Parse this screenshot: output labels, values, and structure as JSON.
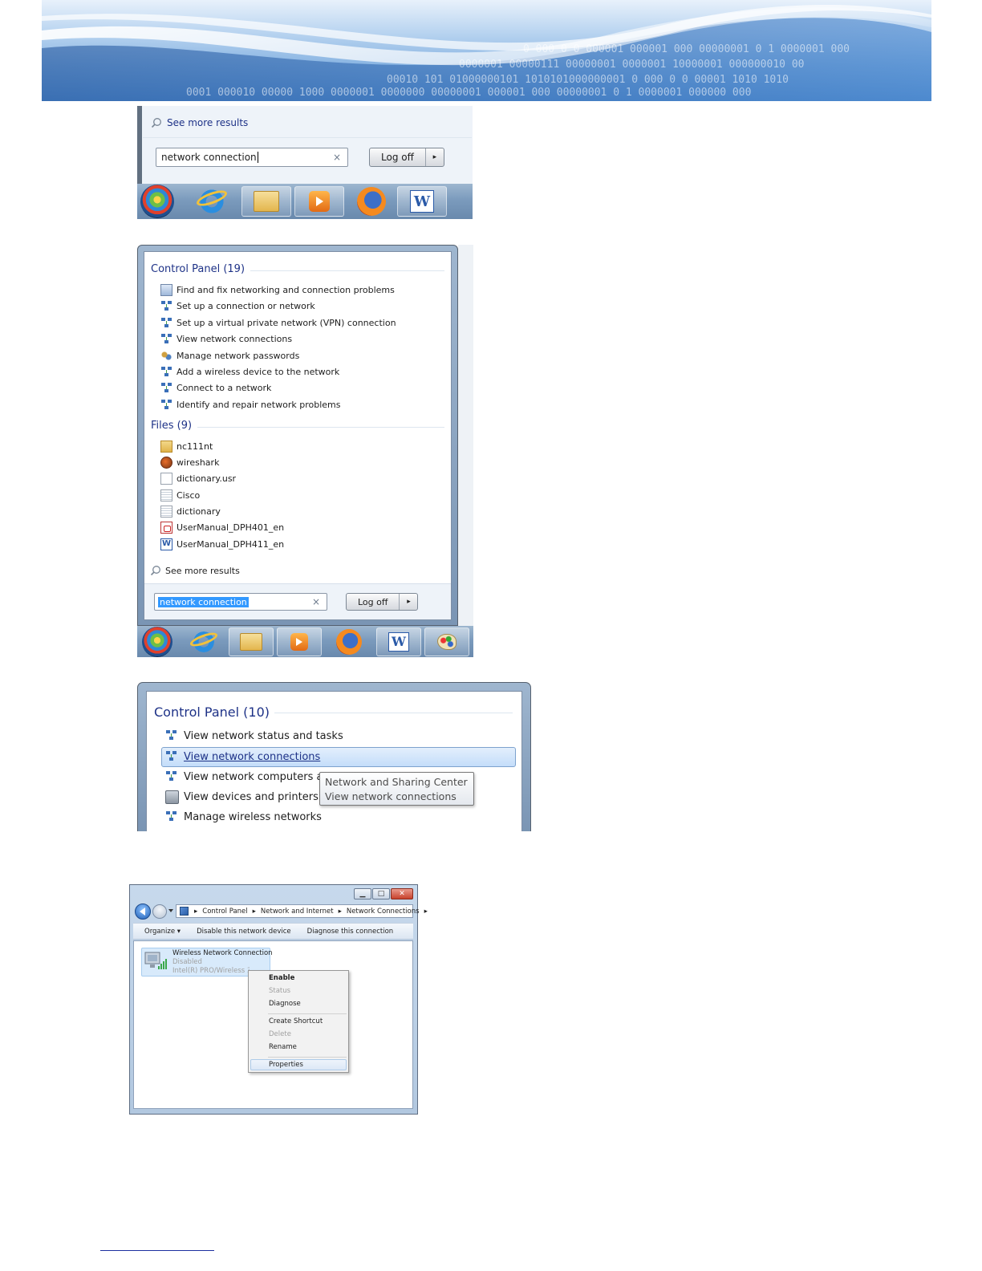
{
  "banner": {
    "binary_lines": [
      "0 000 0 0 000001 000001 000 00000001 0 1 0000001 000",
      "0000001 00000111 00000001 0000001 10000001 000000010 00",
      "00010 101 01000000101 1010101000000001 0 000 0 0 00001 1010 1010",
      "0001 000010 00000 1000 0000001 0000000  00000001 000001 000 00000001 0 1 0000001 000000 000"
    ]
  },
  "shot1": {
    "see_more": "See more results",
    "search_value": "network connection",
    "clear_glyph": "×",
    "logoff": "Log off",
    "logoff_arrow": "▸"
  },
  "shot2": {
    "control_panel_header": "Control Panel (19)",
    "control_panel_items": [
      "Find and fix networking and connection problems",
      "Set up a connection or network",
      "Set up a virtual private network (VPN) connection",
      "View network connections",
      "Manage network passwords",
      "Add a wireless device to the network",
      "Connect to a network",
      "Identify and repair network problems"
    ],
    "files_header": "Files (9)",
    "files_items": [
      "nc111nt",
      "wireshark",
      "dictionary.usr",
      "Cisco",
      "dictionary",
      "UserManual_DPH401_en",
      "UserManual_DPH411_en"
    ],
    "see_more": "See more results",
    "search_value": "network connection",
    "clear_glyph": "×",
    "logoff": "Log off",
    "logoff_arrow": "▸"
  },
  "shot3": {
    "header": "Control Panel (10)",
    "items": [
      "View network status and tasks",
      "View network connections",
      "View network computers a",
      "View devices and printers",
      "Manage wireless networks"
    ],
    "tooltip_line1": "Network and Sharing Center",
    "tooltip_line2": "View network connections"
  },
  "shot4": {
    "caption_min": "▁",
    "caption_max": "□",
    "caption_close": "✕",
    "breadcrumb": [
      "Control Panel",
      "Network and Internet",
      "Network Connections"
    ],
    "breadcrumb_sep": "▸",
    "commands": [
      "Organize ▾",
      "Disable this network device",
      "Diagnose this connection"
    ],
    "connection_name": "Wireless Network Connection",
    "connection_status": "Disabled",
    "connection_adapter": "Intel(R) PRO/Wireless 3945",
    "menu": {
      "enable": "Enable",
      "status": "Status",
      "diagnose": "Diagnose",
      "create_shortcut": "Create Shortcut",
      "delete": "Delete",
      "rename": "Rename",
      "properties": "Properties"
    }
  },
  "colors": {
    "section_title": "#1e3287",
    "selection": "#3399ff",
    "hover": "#cfe3fb",
    "footer_rule": "#1c2fa0"
  }
}
